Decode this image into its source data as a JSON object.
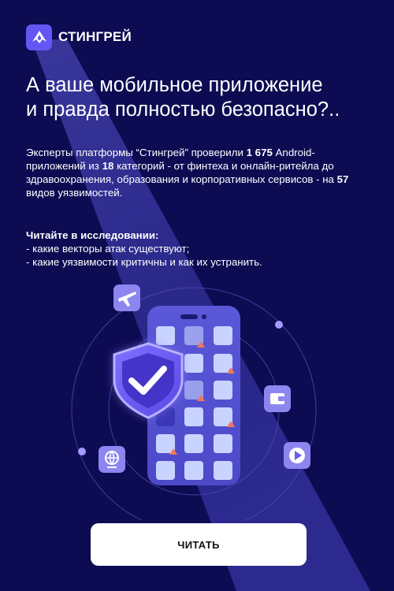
{
  "brand": {
    "name": "СТИНГРЕЙ"
  },
  "headline": {
    "line1": "А ваше мобильное приложение",
    "line2": "и правда полностью безопасно?.."
  },
  "intro": {
    "p1": "Эксперты платформы “Стингрей” проверили ",
    "n1": "1 675",
    "p2": " Android-приложений из ",
    "n2": "18",
    "p3": " категорий - от финтеха и онлайн-ритейла до здравоохранения, образования и корпоративных сервисов - на ",
    "n3": "57",
    "p4": " видов уязвимостей."
  },
  "study": {
    "title": "Читайте в исследовании:",
    "items": [
      "- какие векторы атак существуют;",
      "- какие уязвимости критичны и как их устранить."
    ]
  },
  "cta": {
    "label": "ЧИТАТЬ"
  },
  "colors": {
    "background": "#0d0b52",
    "accent": "#6456f2",
    "tile": "#c9d3ff",
    "warning": "#f0785a"
  },
  "icons": [
    "stingray-logo-icon",
    "airplane-icon",
    "globe-icon",
    "wallet-icon",
    "play-icon",
    "shield-check-icon",
    "warning-icon"
  ]
}
